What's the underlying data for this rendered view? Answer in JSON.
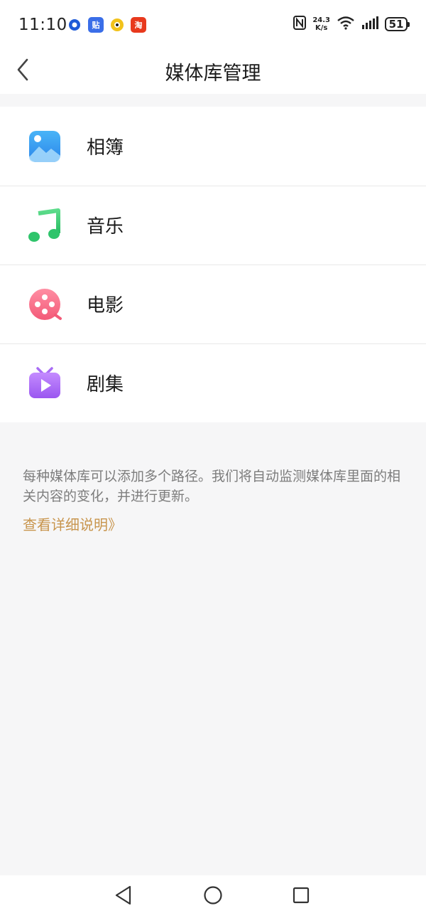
{
  "status_bar": {
    "time": "11:10",
    "apps": [
      {
        "name": "circle-app-icon",
        "glyph": "●",
        "color": "#1f5bd8"
      },
      {
        "name": "tieba-app-icon",
        "glyph": "贴",
        "color": "#3a6ee8"
      },
      {
        "name": "yellow-app-icon",
        "glyph": "◕",
        "color": "#f2c21b"
      },
      {
        "name": "taobao-app-icon",
        "glyph": "淘",
        "color": "#e8391d"
      }
    ],
    "net_speed_value": "24.3",
    "net_speed_unit": "K/s",
    "battery": "51"
  },
  "header": {
    "title": "媒体库管理"
  },
  "library": {
    "items": [
      {
        "label": "相簿",
        "icon": "album-icon"
      },
      {
        "label": "音乐",
        "icon": "music-icon"
      },
      {
        "label": "电影",
        "icon": "movie-icon"
      },
      {
        "label": "剧集",
        "icon": "tv-series-icon"
      }
    ]
  },
  "description": {
    "text": "每种媒体库可以添加多个路径。我们将自动监测媒体库里面的相关内容的变化，并进行更新。",
    "link": "查看详细说明》"
  },
  "colors": {
    "link": "#c8954d",
    "background": "#f6f6f7"
  }
}
